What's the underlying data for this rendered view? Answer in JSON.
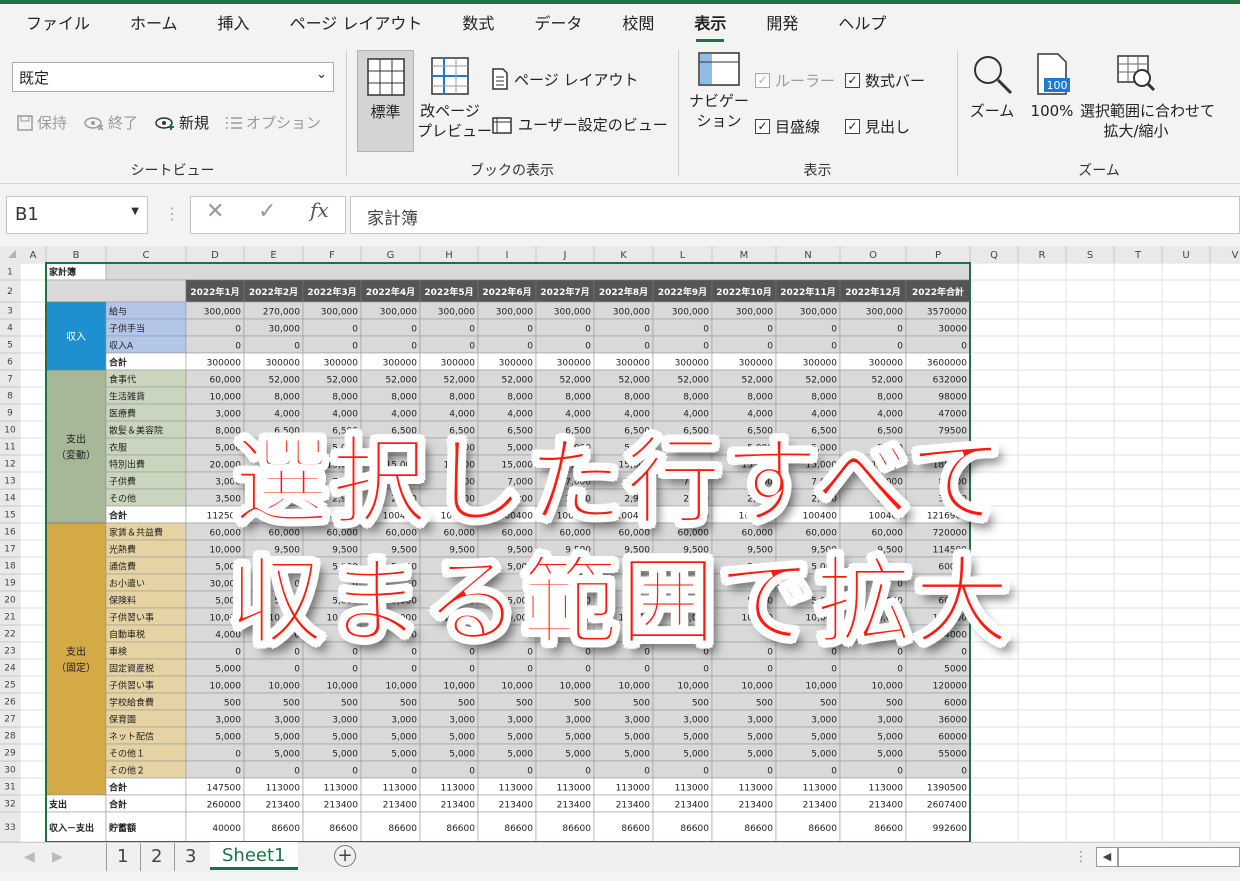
{
  "menu_tabs": [
    "ファイル",
    "ホーム",
    "挿入",
    "ページ レイアウト",
    "数式",
    "データ",
    "校閲",
    "表示",
    "開発",
    "ヘルプ"
  ],
  "active_tab": "表示",
  "sheet_view": {
    "select_value": "既定",
    "keep": "保持",
    "exit": "終了",
    "new": "新規",
    "options": "オプション",
    "group_label": "シートビュー"
  },
  "book_view": {
    "normal": "標準",
    "page_break": "改ページ\nプレビュー",
    "page_layout": "ページ レイアウト",
    "custom_views": "ユーザー設定のビュー",
    "group_label": "ブックの表示"
  },
  "show": {
    "navigation": "ナビゲー\nション",
    "ruler": "ルーラー",
    "formula_bar": "数式バー",
    "gridlines": "目盛線",
    "headings": "見出し",
    "group_label": "表示"
  },
  "zoom": {
    "zoom": "ズーム",
    "hundred": "100%",
    "fit": "選択範囲に合わせて\n拡大/縮小",
    "group_label": "ズーム",
    "icon_text": "100"
  },
  "formula": {
    "namebox": "B1",
    "fx": "fx",
    "content": "家計簿"
  },
  "columns": [
    "A",
    "B",
    "C",
    "D",
    "E",
    "F",
    "G",
    "H",
    "I",
    "J",
    "K",
    "L",
    "M",
    "N",
    "O",
    "P",
    "Q",
    "R",
    "S",
    "T",
    "U",
    "V"
  ],
  "sheet": {
    "title": "家計簿",
    "months": [
      "2022年1月",
      "2022年2月",
      "2022年3月",
      "2022年4月",
      "2022年5月",
      "2022年6月",
      "2022年7月",
      "2022年8月",
      "2022年9月",
      "2022年10月",
      "2022年11月",
      "2022年12月",
      "2022年合計"
    ],
    "categories": [
      {
        "label": "収入",
        "row_start": 3,
        "row_end": 6,
        "color": "#1e90d0",
        "text_color": "#ffffff"
      },
      {
        "label": "支出\n（変動）",
        "row_start": 7,
        "row_end": 15,
        "color": "#a7b898",
        "text_color": "#222222"
      },
      {
        "label": "支出\n（固定）",
        "row_start": 16,
        "row_end": 31,
        "color": "#d4aa47",
        "text_color": "#222222"
      }
    ],
    "rows": [
      {
        "r": 3,
        "item": "給与",
        "vals": [
          "300,000",
          "270,000",
          "300,000",
          "300,000",
          "300,000",
          "300,000",
          "300,000",
          "300,000",
          "300,000",
          "300,000",
          "300,000",
          "300,000",
          "3570000"
        ]
      },
      {
        "r": 4,
        "item": "子供手当",
        "vals": [
          "0",
          "30,000",
          "0",
          "0",
          "0",
          "0",
          "0",
          "0",
          "0",
          "0",
          "0",
          "0",
          "30000"
        ]
      },
      {
        "r": 5,
        "item": "収入A",
        "vals": [
          "0",
          "0",
          "0",
          "0",
          "0",
          "0",
          "0",
          "0",
          "0",
          "0",
          "0",
          "0",
          "0"
        ]
      },
      {
        "r": 6,
        "item": "合計",
        "total": true,
        "vals": [
          "300000",
          "300000",
          "300000",
          "300000",
          "300000",
          "300000",
          "300000",
          "300000",
          "300000",
          "300000",
          "300000",
          "300000",
          "3600000"
        ]
      },
      {
        "r": 7,
        "item": "食事代",
        "vals": [
          "60,000",
          "52,000",
          "52,000",
          "52,000",
          "52,000",
          "52,000",
          "52,000",
          "52,000",
          "52,000",
          "52,000",
          "52,000",
          "52,000",
          "632000"
        ]
      },
      {
        "r": 8,
        "item": "生活雑貨",
        "vals": [
          "10,000",
          "8,000",
          "8,000",
          "8,000",
          "8,000",
          "8,000",
          "8,000",
          "8,000",
          "8,000",
          "8,000",
          "8,000",
          "8,000",
          "98000"
        ]
      },
      {
        "r": 9,
        "item": "医療費",
        "vals": [
          "3,000",
          "4,000",
          "4,000",
          "4,000",
          "4,000",
          "4,000",
          "4,000",
          "4,000",
          "4,000",
          "4,000",
          "4,000",
          "4,000",
          "47000"
        ]
      },
      {
        "r": 10,
        "item": "散髪＆美容院",
        "vals": [
          "8,000",
          "6,500",
          "6,500",
          "6,500",
          "6,500",
          "6,500",
          "6,500",
          "6,500",
          "6,500",
          "6,500",
          "6,500",
          "6,500",
          "79500"
        ]
      },
      {
        "r": 11,
        "item": "衣服",
        "vals": [
          "5,000",
          "5,000",
          "5,000",
          "5,000",
          "5,000",
          "5,000",
          "5,000",
          "5,000",
          "5,000",
          "5,000",
          "5,000",
          "5,000",
          "60000"
        ]
      },
      {
        "r": 12,
        "item": "特別出費",
        "vals": [
          "20,000",
          "15,000",
          "15,000",
          "15,000",
          "15,000",
          "15,000",
          "15,000",
          "15,000",
          "15,000",
          "15,000",
          "15,000",
          "15,000",
          "185000"
        ]
      },
      {
        "r": 13,
        "item": "子供費",
        "vals": [
          "3,000",
          "7,000",
          "7,000",
          "7,000",
          "7,000",
          "7,000",
          "7,000",
          "7,000",
          "7,000",
          "7,000",
          "7,000",
          "7,000",
          "80000"
        ]
      },
      {
        "r": 14,
        "item": "その他",
        "vals": [
          "3,500",
          "2,900",
          "2,900",
          "2,900",
          "2,900",
          "2,900",
          "2,900",
          "2,900",
          "2,900",
          "2,900",
          "2,900",
          "2,900",
          "35400"
        ]
      },
      {
        "r": 15,
        "item": "合計",
        "total": true,
        "vals": [
          "112500",
          "100400",
          "100400",
          "100400",
          "100400",
          "100400",
          "100400",
          "100400",
          "100400",
          "100400",
          "100400",
          "100400",
          "1216900"
        ]
      },
      {
        "r": 16,
        "item": "家賃＆共益費",
        "vals": [
          "60,000",
          "60,000",
          "60,000",
          "60,000",
          "60,000",
          "60,000",
          "60,000",
          "60,000",
          "60,000",
          "60,000",
          "60,000",
          "60,000",
          "720000"
        ]
      },
      {
        "r": 17,
        "item": "光熱費",
        "vals": [
          "10,000",
          "9,500",
          "9,500",
          "9,500",
          "9,500",
          "9,500",
          "9,500",
          "9,500",
          "9,500",
          "9,500",
          "9,500",
          "9,500",
          "114500"
        ]
      },
      {
        "r": 18,
        "item": "通信費",
        "vals": [
          "5,000",
          "5,000",
          "5,000",
          "5,000",
          "5,000",
          "5,000",
          "5,000",
          "5,000",
          "5,000",
          "5,000",
          "5,000",
          "5,000",
          "60000"
        ]
      },
      {
        "r": 19,
        "item": "お小遣い",
        "vals": [
          "30,000",
          "0",
          "0",
          "0",
          "0",
          "0",
          "0",
          "0",
          "0",
          "0",
          "0",
          "0",
          "30000"
        ]
      },
      {
        "r": 20,
        "item": "保険料",
        "vals": [
          "5,000",
          "5,000",
          "5,000",
          "5,000",
          "5,000",
          "5,000",
          "5,000",
          "5,000",
          "5,000",
          "5,000",
          "5,000",
          "5,000",
          "60000"
        ]
      },
      {
        "r": 21,
        "item": "子供習い事",
        "vals": [
          "10,000",
          "10,000",
          "10,000",
          "10,000",
          "10,000",
          "10,000",
          "10,000",
          "10,000",
          "10,000",
          "10,000",
          "10,000",
          "10,000",
          "120000"
        ]
      },
      {
        "r": 22,
        "item": "自動車税",
        "vals": [
          "4,000",
          "0",
          "0",
          "0",
          "0",
          "0",
          "0",
          "0",
          "0",
          "0",
          "0",
          "0",
          "4000"
        ]
      },
      {
        "r": 23,
        "item": "車検",
        "vals": [
          "0",
          "0",
          "0",
          "0",
          "0",
          "0",
          "0",
          "0",
          "0",
          "0",
          "0",
          "0",
          "0"
        ]
      },
      {
        "r": 24,
        "item": "固定資産税",
        "vals": [
          "5,000",
          "0",
          "0",
          "0",
          "0",
          "0",
          "0",
          "0",
          "0",
          "0",
          "0",
          "0",
          "5000"
        ]
      },
      {
        "r": 25,
        "item": "子供習い事",
        "vals": [
          "10,000",
          "10,000",
          "10,000",
          "10,000",
          "10,000",
          "10,000",
          "10,000",
          "10,000",
          "10,000",
          "10,000",
          "10,000",
          "10,000",
          "120000"
        ]
      },
      {
        "r": 26,
        "item": "学校給食費",
        "vals": [
          "500",
          "500",
          "500",
          "500",
          "500",
          "500",
          "500",
          "500",
          "500",
          "500",
          "500",
          "500",
          "6000"
        ]
      },
      {
        "r": 27,
        "item": "保育園",
        "vals": [
          "3,000",
          "3,000",
          "3,000",
          "3,000",
          "3,000",
          "3,000",
          "3,000",
          "3,000",
          "3,000",
          "3,000",
          "3,000",
          "3,000",
          "36000"
        ]
      },
      {
        "r": 28,
        "item": "ネット配信",
        "vals": [
          "5,000",
          "5,000",
          "5,000",
          "5,000",
          "5,000",
          "5,000",
          "5,000",
          "5,000",
          "5,000",
          "5,000",
          "5,000",
          "5,000",
          "60000"
        ]
      },
      {
        "r": 29,
        "item": "その他１",
        "vals": [
          "0",
          "5,000",
          "5,000",
          "5,000",
          "5,000",
          "5,000",
          "5,000",
          "5,000",
          "5,000",
          "5,000",
          "5,000",
          "5,000",
          "55000"
        ]
      },
      {
        "r": 30,
        "item": "その他２",
        "vals": [
          "0",
          "0",
          "0",
          "0",
          "0",
          "0",
          "0",
          "0",
          "0",
          "0",
          "0",
          "0",
          "0"
        ]
      },
      {
        "r": 31,
        "item": "合計",
        "total": true,
        "vals": [
          "147500",
          "113000",
          "113000",
          "113000",
          "113000",
          "113000",
          "113000",
          "113000",
          "113000",
          "113000",
          "113000",
          "113000",
          "1390500"
        ]
      },
      {
        "r": 32,
        "cat": "支出",
        "item": "合計",
        "vals": [
          "260000",
          "213400",
          "213400",
          "213400",
          "213400",
          "213400",
          "213400",
          "213400",
          "213400",
          "213400",
          "213400",
          "213400",
          "2607400"
        ]
      },
      {
        "r": 33,
        "cat": "収入－支出",
        "item": "貯蓄額",
        "vals": [
          "40000",
          "86600",
          "86600",
          "86600",
          "86600",
          "86600",
          "86600",
          "86600",
          "86600",
          "86600",
          "86600",
          "86600",
          "992600"
        ]
      }
    ]
  },
  "sheet_tabs": [
    "1",
    "2",
    "3",
    "Sheet1"
  ],
  "active_sheet": "Sheet1",
  "overlay": {
    "line1": "選択した行すべて",
    "line2": "収まる範囲で拡大"
  },
  "colors": {
    "accent": "#1e7145",
    "header_dark": "#555555",
    "overlay_red": "#ff1a0f",
    "item_blue": "#b4c6e7",
    "item_green": "#c9d6bd",
    "item_tan": "#e6d3a4",
    "data_gray": "#d9d9d9"
  }
}
